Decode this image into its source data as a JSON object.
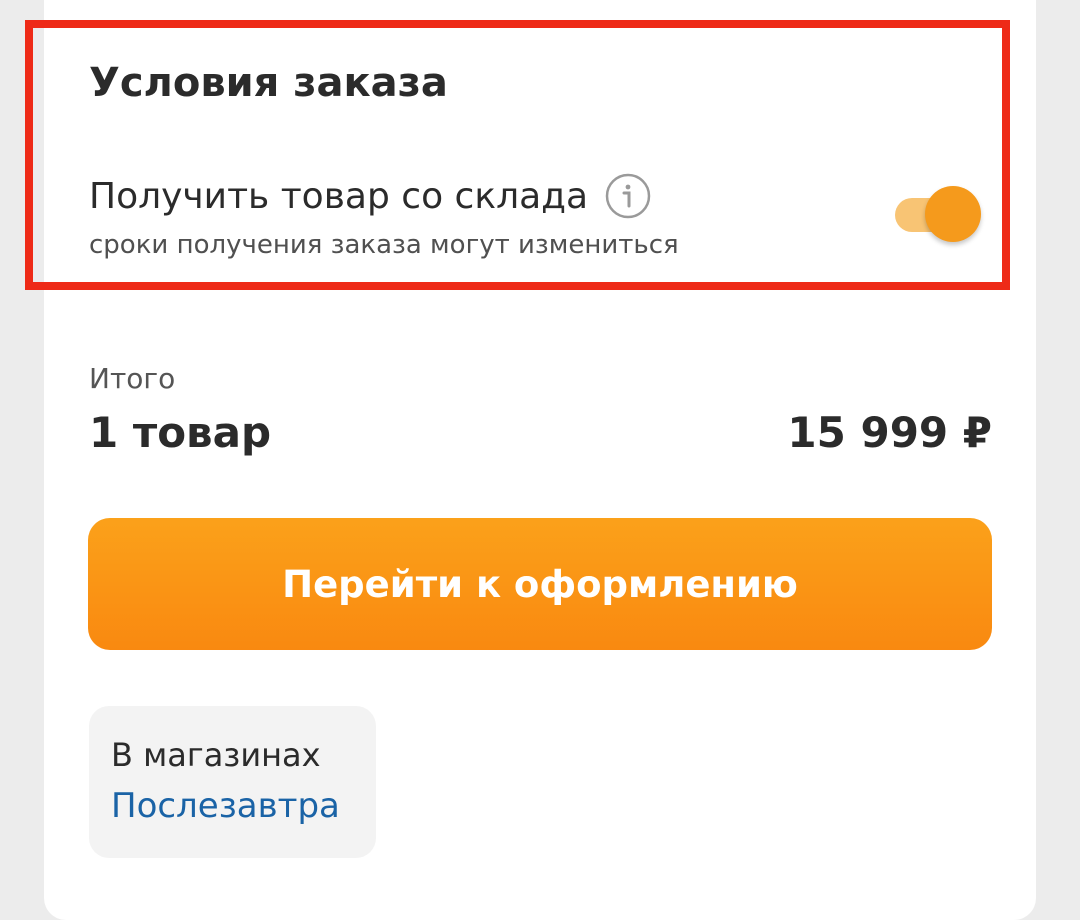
{
  "order_conditions": {
    "title": "Условия заказа",
    "option_label": "Получить товар со склада",
    "option_subtitle": "сроки получения заказа могут измениться",
    "toggle_on": true,
    "accent_color": "#f59a1c"
  },
  "summary": {
    "total_label": "Итого",
    "items_count": "1 товар",
    "total_price": "15 999 ₽"
  },
  "checkout": {
    "button_label": "Перейти к оформлению",
    "button_color": "#f98f12"
  },
  "availability": {
    "label": "В магазинах",
    "date": "Послезавтра",
    "date_color": "#1a63a6"
  },
  "highlight_color": "#ee2a17"
}
